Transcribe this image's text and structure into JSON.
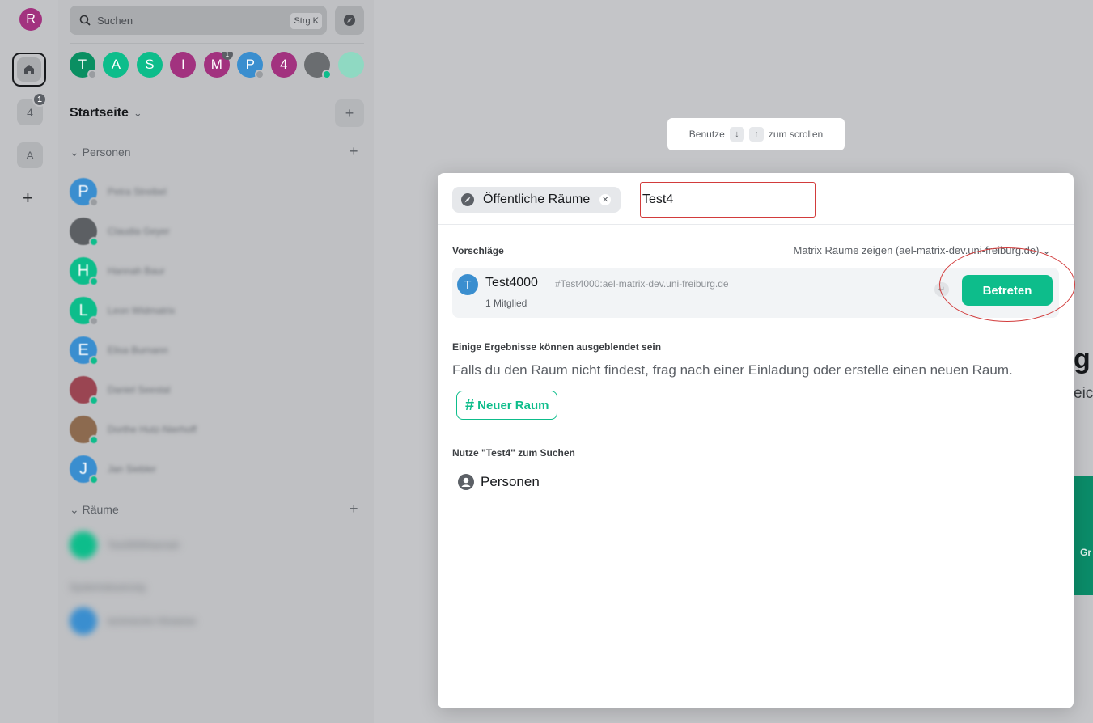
{
  "spacebar": {
    "user_initial": "R",
    "spaces": [
      {
        "label": "4",
        "badge": "1"
      },
      {
        "label": "A"
      }
    ],
    "add": "+"
  },
  "roomlist": {
    "search_placeholder": "Suchen",
    "search_shortcut": "Strg K",
    "recent": [
      {
        "initial": "T",
        "color": "#0a8f62"
      },
      {
        "initial": "A",
        "color": "#0dbd8b"
      },
      {
        "initial": "S",
        "color": "#0dbd8b"
      },
      {
        "initial": "I",
        "color": "#a2327f"
      },
      {
        "initial": "M",
        "color": "#a2327f",
        "badge": "1"
      },
      {
        "initial": "P",
        "color": "#3a8ecf"
      },
      {
        "initial": "4",
        "color": "#a2327f"
      }
    ],
    "home_title": "Startseite",
    "home_add": "+",
    "people_section": "Personen",
    "rooms_section": "Räume",
    "people": [
      {
        "initial": "P",
        "name": "Petra Streibel",
        "color": "#3a8ecf",
        "status": "#9a9da1"
      },
      {
        "initial": "",
        "name": "Claudia Geyer",
        "color": "#5c5f63",
        "status": "#0dbd8b"
      },
      {
        "initial": "H",
        "name": "Hannah Baur",
        "color": "#0dbd8b",
        "status": "#0dbd8b"
      },
      {
        "initial": "L",
        "name": "Leon Widmatrix",
        "color": "#0dbd8b",
        "status": "#9a9da1"
      },
      {
        "initial": "E",
        "name": "Elisa Burnann",
        "color": "#3a8ecf",
        "status": "#0dbd8b"
      },
      {
        "initial": "",
        "name": "Daniel Seestal",
        "color": "#9a4552",
        "status": "#0dbd8b"
      },
      {
        "initial": "",
        "name": "Dorthe Hutz-Nierhoff",
        "color": "#8c6a4f",
        "status": "#0dbd8b"
      },
      {
        "initial": "J",
        "name": "Jan Siebler",
        "color": "#3a8ecf",
        "status": "#0dbd8b"
      }
    ],
    "rooms": [
      {
        "name": "Test3000hannah",
        "color": "#0dbd8b"
      },
      {
        "name": "Systemsteuerung",
        "color": ""
      },
      {
        "name": "technische Hinweise",
        "color": "#3a8ecf"
      }
    ]
  },
  "scroll_hint": {
    "prefix": "Benutze",
    "down": "↓",
    "up": "↑",
    "suffix": "zum scrollen"
  },
  "background": {
    "peek_heading": "g",
    "peek_sub": "eic",
    "peek_card": "Gr"
  },
  "dialog": {
    "filter_label": "Öffentliche Räume",
    "query": "Test4",
    "suggestions_label": "Vorschläge",
    "server_select": "Matrix Räume zeigen (ael-matrix-dev.uni-freiburg.de)",
    "result": {
      "initial": "T",
      "name": "Test4000",
      "alias": "#Test4000:ael-matrix-dev.uni-freiburg.de",
      "members": "1 Mitglied",
      "join_label": "Betreten"
    },
    "hidden_results_label": "Einige Ergebnisse können ausgeblendet sein",
    "hidden_results_text": "Falls du den Raum nicht findest, frag nach einer Einladung oder erstelle einen neuen Raum.",
    "new_room_label": "Neuer Raum",
    "use_query_label": "Nutze \"Test4\" zum Suchen",
    "people_option": "Personen"
  },
  "colors": {
    "accent": "#0dbd8b",
    "annotation": "#d23b3b"
  }
}
